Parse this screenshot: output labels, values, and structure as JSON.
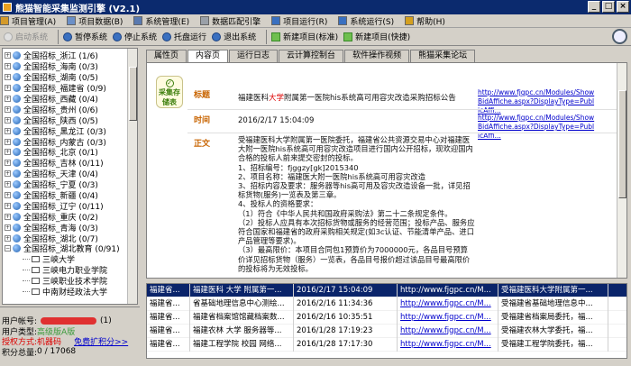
{
  "title": "熊猫智能采集监测引擎  (V2.1)",
  "menu": [
    {
      "label": "项目管理(A)",
      "icon": "folder-icon",
      "color": "#d49a2a"
    },
    {
      "label": "项目数据(B)",
      "icon": "data-icon",
      "color": "#6b8fc7"
    },
    {
      "label": "系统管理(E)",
      "icon": "gear-icon",
      "color": "#5a7ab0"
    },
    {
      "label": "数据匹配引擎",
      "icon": "grid-icon",
      "color": "#9aa0a8"
    },
    {
      "label": "项目运行(R)",
      "icon": "run-icon",
      "color": "#3a70c0"
    },
    {
      "label": "系统运行(S)",
      "icon": "system-icon",
      "color": "#3a70c0"
    },
    {
      "label": "帮助(H)",
      "icon": "help-icon",
      "color": "#d4a020"
    }
  ],
  "toolbar": {
    "start": "启动系统",
    "pause": "暂停系统",
    "stop": "停止系统",
    "tray": "托盘运行",
    "exit": "退出系统",
    "new_standard": "新建项目(标准)",
    "new_quick": "新建项目(快捷)"
  },
  "tree": [
    {
      "label": "全国招标_浙江  (1/6)"
    },
    {
      "label": "全国招标_海南  (0/3)"
    },
    {
      "label": "全国招标_湖南  (0/5)"
    },
    {
      "label": "全国招标_福建省  (0/9)"
    },
    {
      "label": "全国招标_西藏  (0/4)"
    },
    {
      "label": "全国招标_贵州  (0/6)"
    },
    {
      "label": "全国招标_陕西  (0/5)"
    },
    {
      "label": "全国招标_黑龙江  (0/3)"
    },
    {
      "label": "全国招标_内蒙古  (0/3)"
    },
    {
      "label": "全国招标_北京  (0/1)"
    },
    {
      "label": "全国招标_吉林  (0/11)"
    },
    {
      "label": "全国招标_天津  (0/4)"
    },
    {
      "label": "全国招标_宁夏  (0/3)"
    },
    {
      "label": "全国招标_新疆  (0/4)"
    },
    {
      "label": "全国招标_辽宁  (0/11)"
    },
    {
      "label": "全国招标_重庆  (0/2)"
    },
    {
      "label": "全国招标_青海  (0/3)"
    },
    {
      "label": "全国招标_湖北  (0/7)"
    },
    {
      "label": "全国招标_湖北教育  (0/91)"
    }
  ],
  "tree_children": [
    "三峡大学",
    "三峡电力职业学院",
    "三峡职业技术学院",
    "中南财经政法大学"
  ],
  "user": {
    "account_label": "用户帐号:",
    "account_count": "(1)",
    "type_label": "用户类型:",
    "type_value": "高级版A版",
    "auth_label": "授权方式:",
    "auth_value": "机器码",
    "auth_link": "免费扩积分>>",
    "points_label": "积分总量:",
    "points_value": "0 / 17068"
  },
  "tabs": [
    "属性页",
    "内容页",
    "运行日志",
    "云计算控制台",
    "软件操作视频",
    "熊猫采集论坛"
  ],
  "detail": {
    "tag_text": "采集存储表",
    "title_label": "标题",
    "title_pre": "福建医科",
    "title_highlight": "大学",
    "title_post": "附属第一医院his系统高可用容灾改造采购招标公告",
    "link_top": "http://www.fjgpc.cn/Modules/ShowBidAffiche.aspx?DisplayType=PublicAffi...",
    "time_label": "时间",
    "time_value": "2016/2/17 15:04:09",
    "link_bottom": "http://www.fjgpc.cn/Modules/ShowBidAffiche.aspx?DisplayType=PublicAffi...",
    "body_label": "正文",
    "body": "受福建医科大学附属第一医院委托，福建省公共资源交易中心对福建医大附一医院his系统高可用容灾改造项目进行国内公开招标，现欢迎国内合格的投标人前来提交密封的投标。\n1、招标编号：fjggzy[gk]2015340\n2、项目名称：福建医大附一医院his系统高可用容灾改造\n3、招标内容及要求：服务器等his高可用及容灾改造设备一批，详见招标货物(服务)一览表及第三章。\n4、投标人的资格要求：\n（1）符合《中华人民共和国政府采购法》第二十二条规定条件。\n（2）投标人应具有本次招标货物或服务的经营范围；投标产品、服务应符合国家和福建省的政府采购相关规定(如3c认证、节能清单产品、进口产品管理等要求)。\n（3）最高限价：本项目合同包1预算价为7000000元，各品目号预算价详见招标货物（服务）一览表，各品目号报价超过该品目号最高限价的投标将为无效投标。"
  },
  "records": [
    [
      "福建省...",
      "福建医科 大学 附属第一...",
      "2016/2/17 15:04:09",
      "http://www.fjgpc.cn/M...",
      "受福建医科大学附属第一..."
    ],
    [
      "福建省...",
      "省基础地理信息中心测绘...",
      "2016/2/16 11:34:36",
      "http://www.fjgpc.cn/M...",
      "受福建省基础地理信息中..."
    ],
    [
      "福建省...",
      "福建省档案馆馆藏档案数...",
      "2016/2/16 10:35:51",
      "http://www.fjgpc.cn/M...",
      "受福建省档案局委托，福..."
    ],
    [
      "福建省...",
      "福建农林 大学 服务器等...",
      "2016/1/28 17:19:23",
      "http://www.fjgpc.cn/M...",
      "受福建农林大学委托，福..."
    ],
    [
      "福建省...",
      "福建工程学院 校园 网络...",
      "2016/1/28 17:17:30",
      "http://www.fjgpc.cn/M...",
      "受福建工程学院委托，福..."
    ]
  ]
}
